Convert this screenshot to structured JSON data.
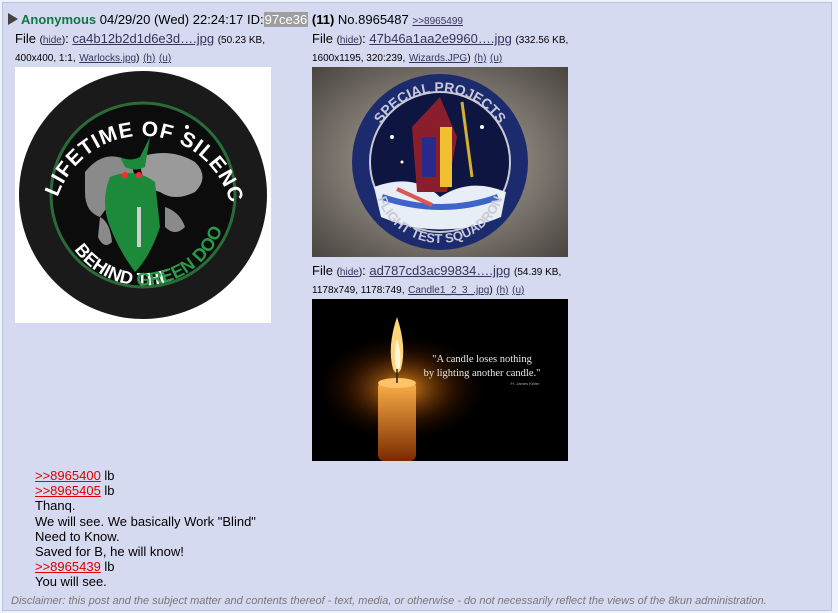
{
  "post": {
    "name": "Anonymous",
    "datetime": "04/29/20 (Wed) 22:24:17",
    "id_label": "ID:",
    "id_value": "97ce36",
    "reply_count": "(11)",
    "post_no": "No.8965487",
    "backlink": ">>8965499"
  },
  "files": [
    {
      "label": "File",
      "hide": "hide",
      "filename": "ca4b12b2d1d6e3d….jpg",
      "size": "(50.23 KB,",
      "dims": "400x400, 1:1,",
      "orig_name": "Warlocks.jpg",
      "h": "(h)",
      "u": "(u)",
      "patch_text_top": "A LIFETIME OF SILENCE",
      "patch_text_bottom": "BEHIND THE",
      "patch_text_green": "GREEN DOOR"
    },
    {
      "label": "File",
      "hide": "hide",
      "filename": "47b46a1aa2e9960….jpg",
      "size": "(332.56 KB,",
      "dims": "1600x1195, 320:239,",
      "orig_name": "Wizards.JPG",
      "h": "(h)",
      "u": "(u)",
      "patch_text_top": "SPECIAL PROJECTS",
      "patch_text_bottom": "FLIGHT TEST SQUADRON"
    },
    {
      "label": "File",
      "hide": "hide",
      "filename": "ad787cd3ac99834….jpg",
      "size": "(54.39 KB,",
      "dims": "1178x749, 1178:749,",
      "orig_name": "Candle1_2_3_.jpg",
      "h": "(h)",
      "u": "(u)",
      "quote_line1": "\"A candle loses nothing",
      "quote_line2": "by lighting another candle.\"",
      "quote_author": "Fr. James Keller"
    }
  ],
  "body": [
    {
      "link": ">>8965400",
      "text": " lb"
    },
    {
      "link": ">>8965405",
      "text": " lb"
    },
    {
      "link": "",
      "text": "Thanq."
    },
    {
      "link": "",
      "text": "We will see. We basically Work \"Blind\""
    },
    {
      "link": "",
      "text": "Need to Know."
    },
    {
      "link": "",
      "text": "Saved for B, he will know!"
    },
    {
      "link": ">>8965439",
      "text": " lb"
    },
    {
      "link": "",
      "text": "You will see."
    }
  ],
  "disclaimer": "Disclaimer: this post and the subject matter and contents thereof - text, media, or otherwise - do not necessarily reflect the views of the 8kun administration."
}
